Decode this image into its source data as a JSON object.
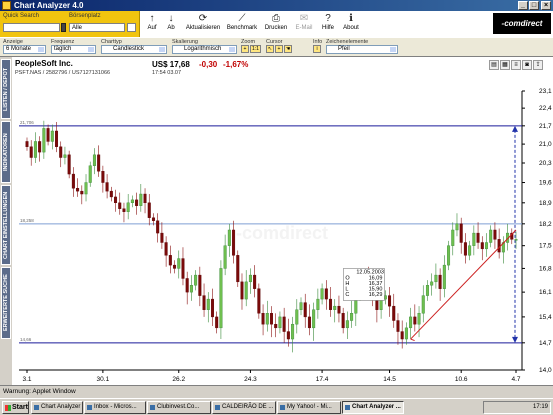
{
  "window": {
    "title": "Chart Analyzer 4.0",
    "minimize": "_",
    "maximize": "□",
    "close": "×"
  },
  "quicksearch": {
    "label": "Quick Search",
    "value": "",
    "exchange_label": "Börsenplatz",
    "exchange_value": "Alle"
  },
  "toolbar": {
    "items": [
      {
        "label": "Auf",
        "icon": "arrow-up-icon",
        "glyph": "↑"
      },
      {
        "label": "Ab",
        "icon": "arrow-down-icon",
        "glyph": "↓"
      },
      {
        "label": "Aktualisieren",
        "icon": "refresh-icon",
        "glyph": "⟳"
      },
      {
        "label": "Benchmark",
        "icon": "benchmark-icon",
        "glyph": "📈"
      },
      {
        "label": "Drucken",
        "icon": "print-icon",
        "glyph": "⎙"
      },
      {
        "label": "E-Mail",
        "icon": "email-icon",
        "glyph": "✉"
      },
      {
        "label": "Hilfe",
        "icon": "help-icon",
        "glyph": "?"
      },
      {
        "label": "About",
        "icon": "info-icon",
        "glyph": "ℹ"
      }
    ],
    "brand": "-comdirect"
  },
  "controls": {
    "anzeige": {
      "label": "Anzeige",
      "value": "6 Monate"
    },
    "frequenz": {
      "label": "Frequenz",
      "value": "täglich"
    },
    "charttyp": {
      "label": "Charttyp",
      "value": "Candlestick"
    },
    "skalierung": {
      "label": "Skalierung",
      "value": "Logarithmisch"
    },
    "zoom": {
      "label": "Zoom",
      "value": "1:1"
    },
    "cursor": {
      "label": "Cursor",
      "value": ""
    },
    "info": {
      "label": "Info",
      "value": ""
    },
    "zeichenelemente": {
      "label": "Zeichenelemente",
      "value": "Pfeil"
    }
  },
  "sidetabs": [
    "LISTEN / DEPOT",
    "INDIKATOREN",
    "CHART EINSTELLUNGEN",
    "ERWEITERTE SUCHE"
  ],
  "stock": {
    "name": "PeopleSoft Inc.",
    "ids": "PSFT.NAS / 2582796 / US7127131066",
    "price": "US$ 17,68",
    "change": "-0,30",
    "change_pct": "-1,67%",
    "time": "17:54 03.07"
  },
  "tooltip": {
    "date": "12.05.2003",
    "rows": [
      {
        "k": "O",
        "v": "16,09"
      },
      {
        "k": "H",
        "v": "16,37"
      },
      {
        "k": "L",
        "v": "15,90"
      },
      {
        "k": "C",
        "v": "16,29"
      }
    ]
  },
  "chart_data": {
    "type": "candlestick",
    "scale": "logarithmic",
    "ylim": [
      14.0,
      23.1
    ],
    "y_ticks": [
      23.1,
      22.4,
      21.7,
      21.0,
      20.3,
      19.6,
      18.9,
      18.2,
      17.5,
      16.8,
      16.1,
      15.4,
      14.7,
      14.0
    ],
    "x_ticks": [
      "3.1",
      "30.1",
      "26.2",
      "24.3",
      "17.4",
      "14.5",
      "10.6",
      "4.7"
    ],
    "hlines": [
      21.7,
      18.2,
      14.7
    ],
    "hline_labels": [
      "21,706",
      "18,258",
      "14,66"
    ],
    "closes": [
      20.9,
      20.5,
      21.1,
      20.7,
      21.6,
      21.1,
      21.5,
      20.9,
      20.5,
      20.6,
      19.9,
      19.4,
      19.3,
      19.2,
      19.6,
      20.2,
      20.6,
      20.0,
      19.6,
      19.3,
      19.1,
      18.9,
      18.7,
      18.6,
      18.9,
      19.0,
      18.8,
      19.2,
      18.9,
      18.4,
      18.3,
      17.9,
      17.6,
      17.2,
      16.9,
      16.8,
      17.1,
      16.5,
      16.1,
      16.3,
      16.6,
      16.0,
      15.6,
      15.9,
      15.4,
      15.1,
      16.8,
      17.5,
      18.0,
      17.2,
      16.4,
      15.9,
      16.4,
      16.6,
      16.2,
      15.5,
      15.2,
      15.5,
      15.2,
      15.1,
      15.4,
      15.0,
      14.8,
      15.2,
      15.6,
      15.8,
      15.4,
      15.1,
      15.6,
      15.9,
      16.2,
      15.9,
      15.6,
      15.7,
      15.5,
      15.1,
      15.3,
      15.5,
      16.1,
      16.4,
      16.6,
      16.3,
      15.9,
      15.6,
      15.9,
      16.0,
      15.7,
      15.3,
      15.0,
      14.8,
      15.1,
      15.4,
      15.2,
      15.5,
      16.0,
      16.3,
      16.4,
      16.6,
      16.2,
      16.9,
      17.5,
      18.0,
      18.2,
      17.6,
      17.2,
      17.5,
      17.9,
      17.6,
      17.4,
      17.6,
      18.0,
      17.7,
      17.3,
      17.6,
      17.9,
      17.7,
      17.7
    ]
  },
  "statusbar": {
    "text": "Warnung: Applet Window"
  },
  "taskbar": {
    "start": "Start",
    "items": [
      "Chart Analyzer ...",
      "Inbox - Micros...",
      "Clubinvest.Co...",
      "CALDEIRÃO DE ...",
      "My Yahoo! - Mi...",
      "Chart Analyzer ..."
    ],
    "clock": "17:19"
  }
}
